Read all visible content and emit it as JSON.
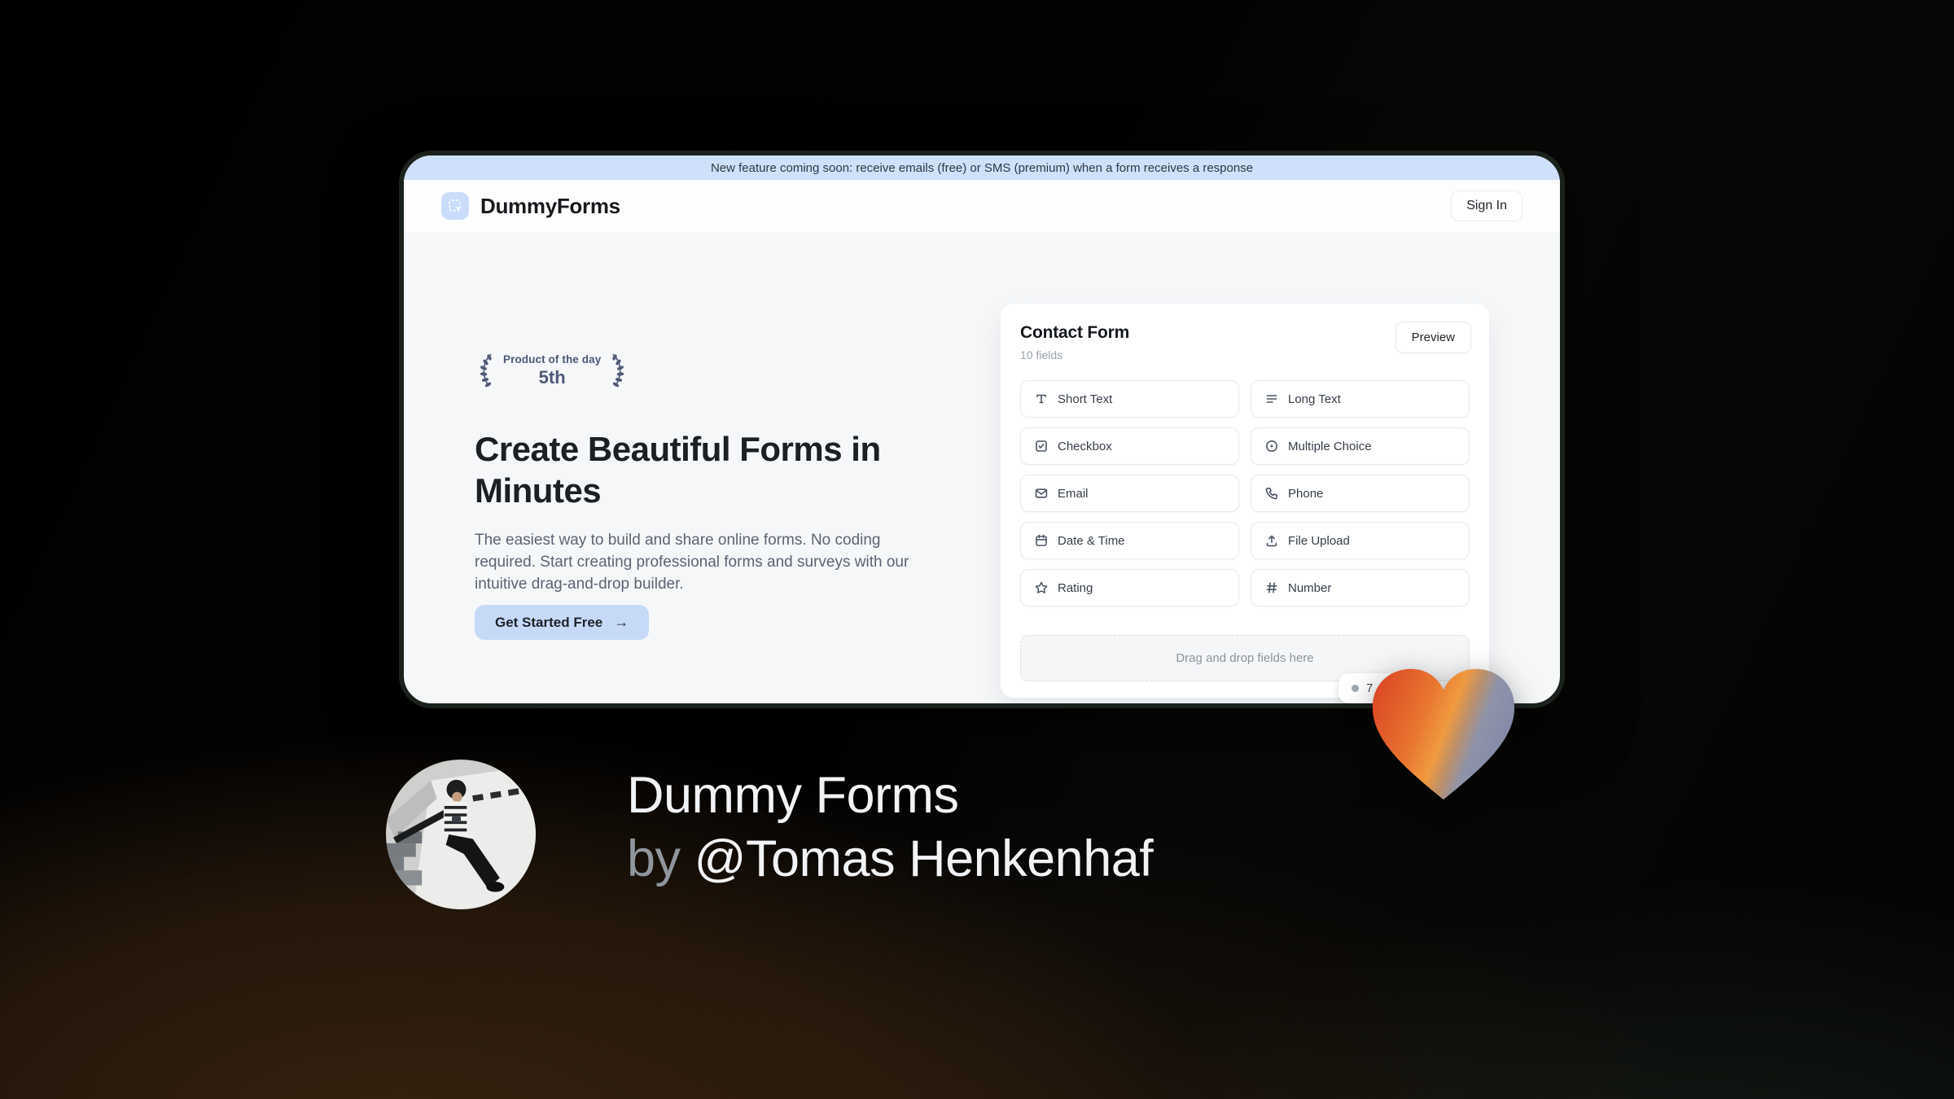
{
  "banner": {
    "text": "New feature coming soon: receive emails (free) or SMS (premium) when a form receives a response"
  },
  "header": {
    "brand": "DummyForms",
    "sign_in_label": "Sign In"
  },
  "hero": {
    "badge_line1": "Product of the day",
    "badge_line2": "5th",
    "title": "Create Beautiful Forms in Minutes",
    "description": "The easiest way to build and share online forms. No coding required. Start creating professional forms and surveys with our intuitive drag-and-drop builder.",
    "cta_label": "Get Started Free",
    "cta_arrow": "→"
  },
  "form_card": {
    "title": "Contact Form",
    "field_count": "10 fields",
    "preview_label": "Preview",
    "fields": [
      {
        "label": "Short Text",
        "icon": "text-icon"
      },
      {
        "label": "Long Text",
        "icon": "align-left-icon"
      },
      {
        "label": "Checkbox",
        "icon": "checkbox-icon"
      },
      {
        "label": "Multiple Choice",
        "icon": "radio-icon"
      },
      {
        "label": "Email",
        "icon": "envelope-icon"
      },
      {
        "label": "Phone",
        "icon": "phone-icon"
      },
      {
        "label": "Date & Time",
        "icon": "calendar-icon"
      },
      {
        "label": "File Upload",
        "icon": "upload-icon"
      },
      {
        "label": "Rating",
        "icon": "star-icon"
      },
      {
        "label": "Number",
        "icon": "hash-icon"
      }
    ],
    "dropzone_text": "Drag and drop fields here"
  },
  "upvote_badge": {
    "text": "7"
  },
  "footer": {
    "title": "Dummy Forms",
    "byline_prefix": "by",
    "byline_name": "@Tomas Henkenhaf"
  },
  "colors": {
    "banner_bg": "#cfe0fb",
    "accent_blue": "#c6daf8",
    "laurel": "#4e5a77",
    "heart_orange": "#dc4a26",
    "heart_amber": "#f09a3f",
    "heart_gray": "#8289a8"
  }
}
